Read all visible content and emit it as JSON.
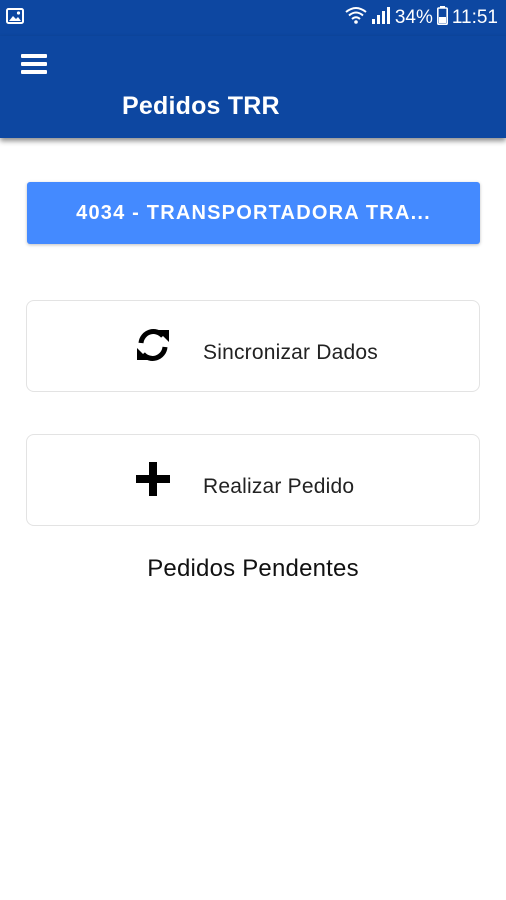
{
  "status_bar": {
    "battery": "34%",
    "time": "11:51",
    "icons": [
      "image-icon",
      "wifi-icon",
      "signal-icon",
      "battery-icon"
    ]
  },
  "app_bar": {
    "title": "Pedidos TRR",
    "menu_icon": "hamburger-menu-icon"
  },
  "company_selector": {
    "label": "4034 - TRANSPORTADORA TRA..."
  },
  "actions": [
    {
      "label": "Sincronizar Dados",
      "icon": "sync-icon"
    },
    {
      "label": "Realizar Pedido",
      "icon": "plus-icon"
    }
  ],
  "pending_section": {
    "title": "Pedidos Pendentes"
  },
  "colors": {
    "app_bar": "#0d47a1",
    "company_button": "#448aff",
    "text": "#222222"
  }
}
